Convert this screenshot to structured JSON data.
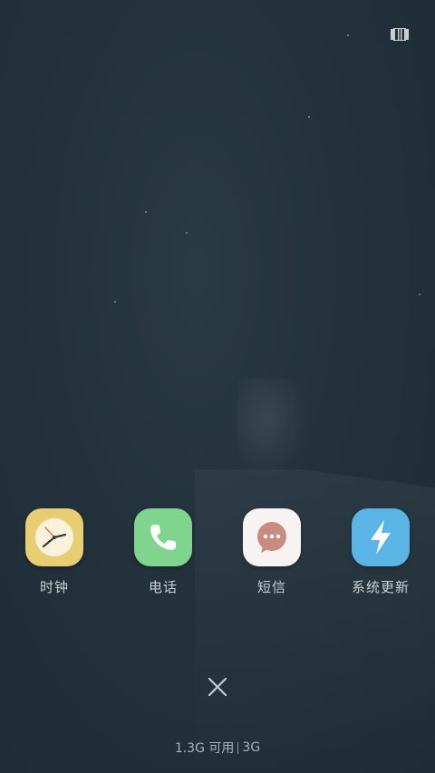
{
  "apps": [
    {
      "label": "时钟",
      "icon": "clock-icon",
      "bg": "#e8cd72"
    },
    {
      "label": "电话",
      "icon": "phone-icon",
      "bg": "#7fd48e"
    },
    {
      "label": "短信",
      "icon": "message-icon",
      "bg": "#f6f3f2"
    },
    {
      "label": "系统更新",
      "icon": "lightning-icon",
      "bg": "#5bb4e6"
    }
  ],
  "memory": {
    "available": "1.3G 可用",
    "total": "3G"
  },
  "colors": {
    "background": "#22313b",
    "label_text": "#c9cfd3",
    "close_icon": "#c3cbd0"
  }
}
